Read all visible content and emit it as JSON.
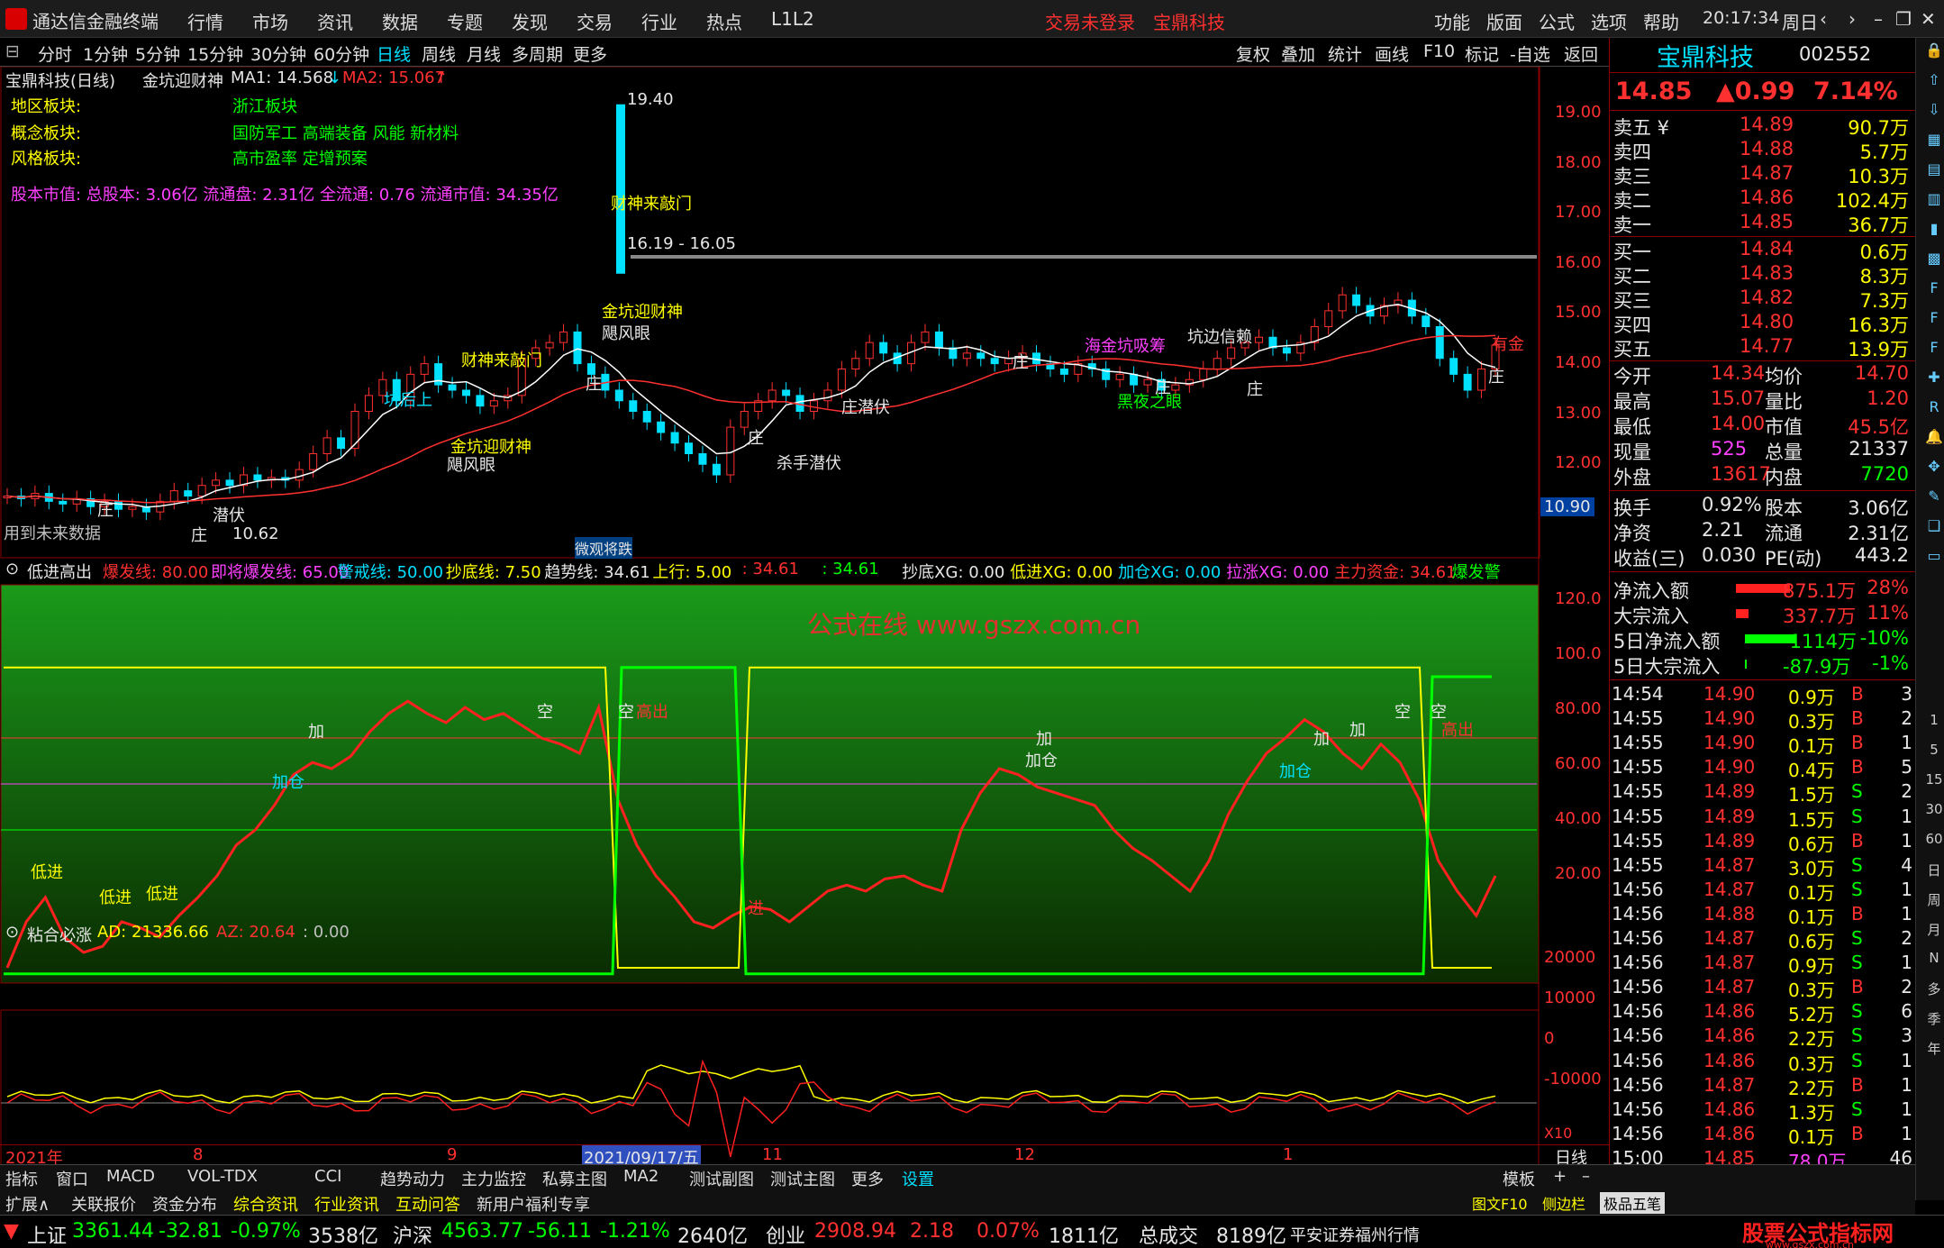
{
  "menubar": {
    "app": "通达信金融终端",
    "items": [
      "行情",
      "市场",
      "资讯",
      "数据",
      "专题",
      "发现",
      "交易",
      "行业",
      "热点",
      "L1L2"
    ],
    "login": "交易未登录",
    "stock": "宝鼎科技",
    "right": [
      "功能",
      "版面",
      "公式",
      "选项",
      "帮助"
    ],
    "time": "20:17:34",
    "day": "周日"
  },
  "toolbar": {
    "periods": [
      "分时",
      "1分钟",
      "5分钟",
      "15分钟",
      "30分钟",
      "60分钟",
      "日线",
      "周线",
      "月线",
      "多周期",
      "更多"
    ],
    "right": [
      "复权",
      "叠加",
      "统计",
      "画线",
      "F10",
      "标记",
      "-自选",
      "返回"
    ]
  },
  "main": {
    "title": "宝鼎科技(日线)",
    "formula": "金坑迎财神",
    "ma1": "MA1: 14.568",
    "ma1_arrow": "↓",
    "ma2": "MA2: 15.067",
    "ma2_arrow": "↑",
    "info": [
      {
        "k": "地区板块:",
        "v": "浙江板块"
      },
      {
        "k": "概念板块:",
        "v": "国防军工 高端装备 风能 新材料"
      },
      {
        "k": "风格板块:",
        "v": "高市盈率 定增预案"
      }
    ],
    "shares": "股本市值: 总股本: 3.06亿 流通盘: 2.31亿 全流通: 0.76 流通市值: 34.35亿",
    "yaxis": [
      "19.00",
      "18.00",
      "17.00",
      "16.00",
      "15.00",
      "14.00",
      "13.00",
      "12.00"
    ],
    "cur_price": "10.90",
    "labels": {
      "high": "19.40",
      "range": "16.19 - 16.05",
      "low": "10.62",
      "future": "用到未来数据",
      "zhuang": "庄",
      "qianfu": "潜伏",
      "kenghoushang": "坑后上",
      "caishen": "财神来敲门",
      "jinkeng": "金坑迎财神",
      "jufeng": "飓风眼",
      "shashou": "杀手潜伏",
      "heiye": "黑夜之眼",
      "kengbian": "坑边信赖",
      "haijin": "海金坑吸筹",
      "youjin": "有金",
      "zhuangqianfu": "庄潜伏",
      "bottom_tag": "微观将跌"
    }
  },
  "ind1": {
    "name": "低进高出",
    "items": [
      {
        "t": "爆发线: 80.00",
        "c": "r"
      },
      {
        "t": "即将爆发线: 65.00",
        "c": "m"
      },
      {
        "t": "警戒线: 50.00",
        "c": "c"
      },
      {
        "t": "抄底线: 7.50",
        "c": "y"
      },
      {
        "t": "趋势线: 34.61",
        "c": "w"
      },
      {
        "t": "上行: 5.00",
        "c": "y"
      },
      {
        "t": ": 34.61",
        "c": "r"
      },
      {
        "t": ": 34.61",
        "c": "g"
      },
      {
        "t": "抄底XG: 0.00",
        "c": "w"
      },
      {
        "t": "低进XG: 0.00",
        "c": "y"
      },
      {
        "t": "加仓XG: 0.00",
        "c": "c"
      },
      {
        "t": "拉涨XG: 0.00",
        "c": "m"
      },
      {
        "t": "主力资金: 34.61",
        "c": "r"
      },
      {
        "t": "爆发警",
        "c": "g"
      }
    ],
    "watermark": "公式在线 www.gszx.com.cn",
    "yaxis": [
      "120.0",
      "100.0",
      "80.00",
      "60.00",
      "40.00",
      "20.00"
    ],
    "marks": {
      "dijin": "低进",
      "jia": "加",
      "jiacang": "加仓",
      "kong": "空",
      "chu": "高出",
      "jin": "进"
    }
  },
  "ind2": {
    "name": "粘合必涨",
    "ad": "AD: 21336.66",
    "az": "AZ: 20.64",
    "z": ": 0.00",
    "yaxis": [
      "20000",
      "10000",
      "0",
      "-10000"
    ],
    "x10": "X10"
  },
  "xaxis": {
    "labels": [
      "2021年",
      "8",
      "9",
      "2021/09/17/五",
      "11",
      "12",
      "1"
    ],
    "mode": "日线"
  },
  "quote": {
    "name": "宝鼎科技",
    "code": "002552",
    "price": "14.85",
    "change": "▲0.99",
    "pct": "7.14%",
    "sells": [
      {
        "l": "卖五 ¥",
        "p": "14.89",
        "v": "90.7万"
      },
      {
        "l": "卖四",
        "p": "14.88",
        "v": "5.7万"
      },
      {
        "l": "卖三",
        "p": "14.87",
        "v": "10.3万"
      },
      {
        "l": "卖二",
        "p": "14.86",
        "v": "102.4万"
      },
      {
        "l": "卖一",
        "p": "14.85",
        "v": "36.7万"
      }
    ],
    "buys": [
      {
        "l": "买一",
        "p": "14.84",
        "v": "0.6万"
      },
      {
        "l": "买二",
        "p": "14.83",
        "v": "8.3万"
      },
      {
        "l": "买三",
        "p": "14.82",
        "v": "7.3万"
      },
      {
        "l": "买四",
        "p": "14.80",
        "v": "16.3万"
      },
      {
        "l": "买五",
        "p": "14.77",
        "v": "13.9万"
      }
    ],
    "stats": [
      [
        "今开",
        "14.34",
        "均价",
        "14.70"
      ],
      [
        "最高",
        "15.07",
        "量比",
        "1.20"
      ],
      [
        "最低",
        "14.00",
        "市值",
        "45.5亿"
      ],
      [
        "现量",
        "525",
        "总量",
        "21337"
      ],
      [
        "外盘",
        "13617",
        "内盘",
        "7720"
      ]
    ],
    "stats2": [
      [
        "换手",
        "0.92%",
        "股本",
        "3.06亿"
      ],
      [
        "净资",
        "2.21",
        "流通",
        "2.31亿"
      ],
      [
        "收益(三)",
        "0.030",
        "PE(动)",
        "443.2"
      ]
    ],
    "flow": [
      [
        "净流入额",
        "875.1万",
        "28%"
      ],
      [
        "大宗流入",
        "337.7万",
        "11%"
      ],
      [
        "5日净流入额",
        "-1114万",
        "-10%"
      ],
      [
        "5日大宗流入",
        "-87.9万",
        "-1%"
      ]
    ],
    "ticks": [
      [
        "14:54",
        "14.90",
        "0.9万",
        "B",
        "3"
      ],
      [
        "14:55",
        "14.90",
        "0.3万",
        "B",
        "2"
      ],
      [
        "14:55",
        "14.90",
        "0.1万",
        "B",
        "1"
      ],
      [
        "14:55",
        "14.90",
        "0.4万",
        "B",
        "5"
      ],
      [
        "14:55",
        "14.89",
        "1.5万",
        "S",
        "2"
      ],
      [
        "14:55",
        "14.89",
        "1.5万",
        "S",
        "1"
      ],
      [
        "14:55",
        "14.89",
        "0.6万",
        "B",
        "1"
      ],
      [
        "14:55",
        "14.87",
        "3.0万",
        "S",
        "4"
      ],
      [
        "14:56",
        "14.87",
        "0.1万",
        "S",
        "1"
      ],
      [
        "14:56",
        "14.88",
        "0.1万",
        "B",
        "1"
      ],
      [
        "14:56",
        "14.87",
        "0.6万",
        "S",
        "2"
      ],
      [
        "14:56",
        "14.87",
        "0.9万",
        "S",
        "1"
      ],
      [
        "14:56",
        "14.87",
        "0.3万",
        "B",
        "2"
      ],
      [
        "14:56",
        "14.86",
        "5.2万",
        "S",
        "6"
      ],
      [
        "14:56",
        "14.86",
        "2.2万",
        "S",
        "3"
      ],
      [
        "14:56",
        "14.86",
        "0.3万",
        "S",
        "1"
      ],
      [
        "14:56",
        "14.87",
        "2.2万",
        "B",
        "1"
      ],
      [
        "14:56",
        "14.86",
        "1.3万",
        "S",
        "1"
      ],
      [
        "14:56",
        "14.86",
        "0.1万",
        "B",
        "1"
      ],
      [
        "15:00",
        "14.85",
        "78.0万",
        "",
        "46"
      ]
    ]
  },
  "bottombar": {
    "row1": [
      "指标",
      "窗口",
      "MACD",
      "VOL-TDX",
      "CCI",
      "趋势动力",
      "主力监控",
      "私募主图",
      "MA2",
      "测试副图",
      "测试主图",
      "更多",
      "设置"
    ],
    "row2": [
      "扩展∧",
      "关联报价",
      "资金分布",
      "综合资讯",
      "行业资讯",
      "互动问答",
      "新用户福利专享"
    ],
    "mb": "模板",
    "f10": "图文F10",
    "side": "侧边栏",
    "jp": "极品五笔"
  },
  "statusbar": {
    "sh": "上证",
    "sh_v": "3361.44",
    "sh_c": "-32.81",
    "sh_p": "-0.97%",
    "sh_a": "3538亿",
    "hs": "沪深",
    "hs_v": "4563.77",
    "hs_c": "-56.11",
    "hs_p": "-1.21%",
    "hs_a": "2640亿",
    "cy": "创业",
    "cy_v": "2908.94",
    "cy_c": "2.18",
    "cy_p": "0.07%",
    "cy_a": "1811亿",
    "total": "总成交",
    "total_v": "8189亿",
    "broker": "平安证券福州行情",
    "logo": "股票公式指标网",
    "logo_url": "www.gszx.com.cn"
  },
  "icons": [
    "lock-icon",
    "up-arrow-icon",
    "down-arrow-icon",
    "chart-icon",
    "table-icon",
    "bar-icon",
    "candle-icon",
    "grid-icon",
    "f10-icon",
    "f2-icon",
    "f3-icon",
    "tool-icon",
    "rsi-icon",
    "bell-icon",
    "move-icon",
    "pen-icon",
    "layer-icon",
    "doc-icon"
  ],
  "periodbar": [
    "1",
    "5",
    "15",
    "30",
    "60",
    "日",
    "周",
    "月",
    "N",
    "多",
    "季",
    "年"
  ],
  "colors": {
    "up": "#ff3030",
    "down": "#00e0ff",
    "ma1": "#ffffff",
    "ma2": "#ff3030",
    "green": "#00ff00",
    "yellow": "#ffff00"
  }
}
